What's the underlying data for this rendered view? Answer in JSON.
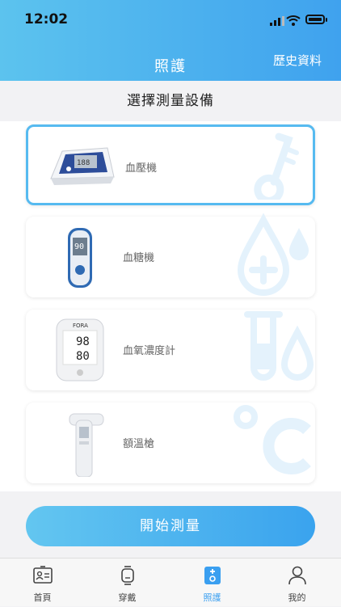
{
  "status_bar": {
    "time": "12:02"
  },
  "header": {
    "title": "照護",
    "history_link": "歷史資料"
  },
  "subtitle": "選擇測量設備",
  "devices": [
    {
      "label": "血壓機",
      "selected": true,
      "icon": "thermometer-icon"
    },
    {
      "label": "血糖機",
      "selected": false,
      "icon": "blood-drop-plus-icon"
    },
    {
      "label": "血氧濃度計",
      "selected": false,
      "icon": "test-tube-drop-icon"
    },
    {
      "label": "額溫槍",
      "selected": false,
      "icon": "celsius-icon"
    }
  ],
  "device_readings": {
    "oximeter_top": "98",
    "oximeter_bottom": "80",
    "oximeter_brand": "FORA",
    "glucometer": "90"
  },
  "start_button": "開始測量",
  "tabs": [
    {
      "label": "首頁",
      "icon": "home-icon",
      "active": false
    },
    {
      "label": "穿戴",
      "icon": "watch-icon",
      "active": false
    },
    {
      "label": "照護",
      "icon": "care-icon",
      "active": true
    },
    {
      "label": "我的",
      "icon": "profile-icon",
      "active": false
    }
  ],
  "colors": {
    "accent": "#3fa2ee",
    "decoration": "#e4f2fc"
  }
}
